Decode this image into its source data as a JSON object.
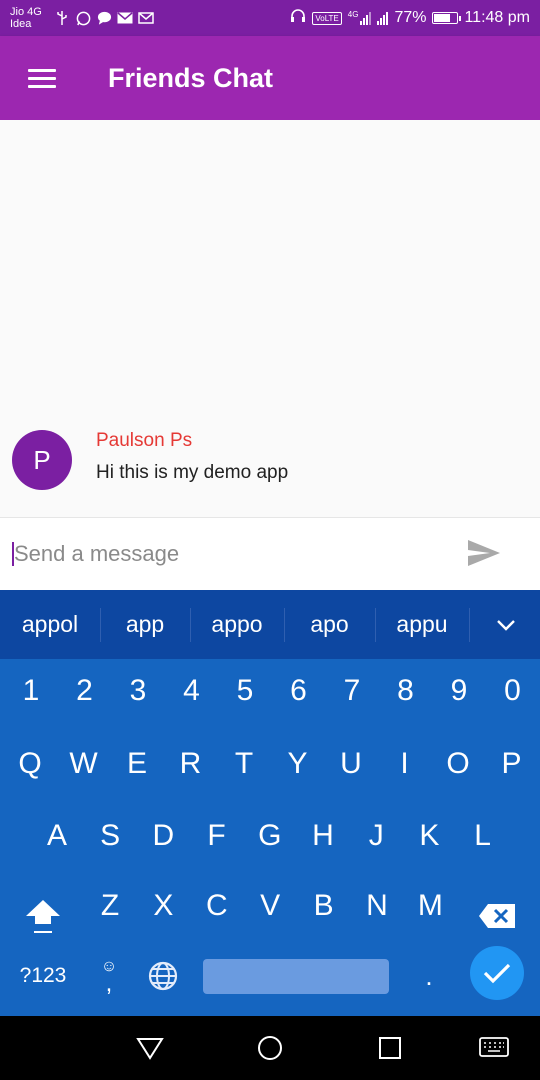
{
  "status_bar": {
    "carrier_line1": "Jio 4G",
    "carrier_line2": "Idea",
    "network": "4G",
    "volte": "VoLTE",
    "battery": "77%",
    "battery_level": 0.77,
    "time": "11:48 pm",
    "icons": [
      "usb-icon",
      "whatsapp-icon",
      "chat-bubble-icon",
      "mail-icon",
      "gmail-icon",
      "headset-icon",
      "signal-icon",
      "battery-icon"
    ]
  },
  "app_bar": {
    "title": "Friends Chat",
    "menu_icon": "hamburger-menu-icon"
  },
  "messages": [
    {
      "avatar_letter": "P",
      "author": "Paulson Ps",
      "text": "Hi this is my demo app"
    }
  ],
  "input": {
    "placeholder": "Send a message",
    "value": "",
    "send_icon": "send-icon"
  },
  "keyboard": {
    "suggestions": [
      "appol",
      "app",
      "appo",
      "apo",
      "appu"
    ],
    "row_numbers": [
      "1",
      "2",
      "3",
      "4",
      "5",
      "6",
      "7",
      "8",
      "9",
      "0"
    ],
    "row_q": [
      "Q",
      "W",
      "E",
      "R",
      "T",
      "Y",
      "U",
      "I",
      "O",
      "P"
    ],
    "row_a": [
      "A",
      "S",
      "D",
      "F",
      "G",
      "H",
      "J",
      "K",
      "L"
    ],
    "row_z": [
      "Z",
      "X",
      "C",
      "V",
      "B",
      "N",
      "M"
    ],
    "symbols_label": "?123",
    "emoji_face": "☺",
    "emoji_comma": ",",
    "period": "."
  },
  "colors": {
    "status_bar": "#7b1fa2",
    "app_bar": "#9c27b0",
    "avatar": "#7b1fa2",
    "author": "#e53935",
    "keyboard": "#1565c0",
    "suggest_bar": "#0d47a1",
    "enter": "#2196f3"
  }
}
